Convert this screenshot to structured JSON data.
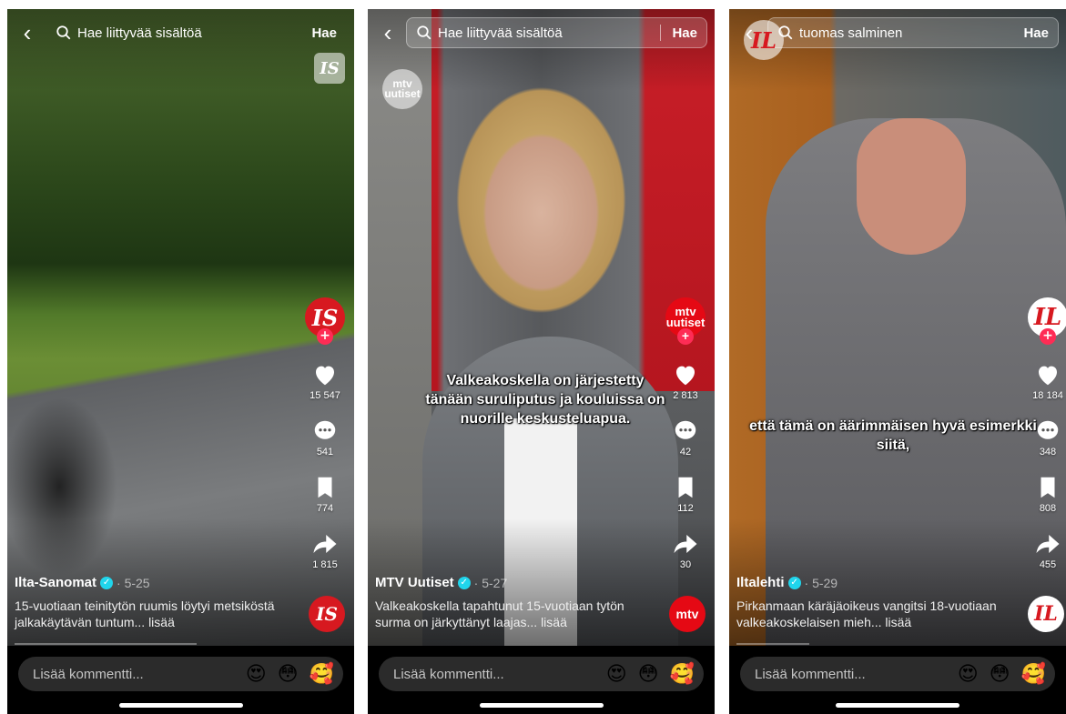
{
  "search_button_label": "Hae",
  "comment_placeholder": "Lisää kommentti...",
  "emojis": [
    "😍",
    "😳",
    "🥰"
  ],
  "colors": {
    "like_red": "#fe2c55",
    "verified": "#20d5ec",
    "comment_bar": "#2b2b2b"
  },
  "screens": [
    {
      "search_text": "Hae liittyvää sisältöä",
      "watermark": "IS",
      "avatar_text": "IS",
      "actions": {
        "likes": "15 547",
        "comments": "541",
        "saves": "774",
        "shares": "1 815"
      },
      "caption": "",
      "author": "Ilta-Sanomat",
      "date": "· 5-25",
      "description": "15-vuotiaan teinitytön ruumis löytyi metsiköstä jalkakäytävän tuntum... lisää",
      "disc_text": "IS"
    },
    {
      "search_text": "Hae liittyvää sisältöä",
      "watermark": "mtv uutiset",
      "avatar_text": "mtv uutiset",
      "actions": {
        "likes": "2 813",
        "comments": "42",
        "saves": "112",
        "shares": "30"
      },
      "caption": "Valkeakoskella on järjestetty tänään suruliputus ja kouluissa on nuorille keskusteluapua.",
      "author": "MTV Uutiset",
      "date": "· 5-27",
      "description": "Valkeakoskella tapahtunut 15-vuotiaan tytön surma on järkyttänyt laajas... lisää",
      "disc_text": "mtv"
    },
    {
      "search_text": "tuomas salminen",
      "watermark": "IL",
      "avatar_text": "IL",
      "actions": {
        "likes": "18 184",
        "comments": "348",
        "saves": "808",
        "shares": "455"
      },
      "caption": "että tämä on äärimmäisen hyvä esimerkki siitä,",
      "author": "Iltalehti",
      "date": "· 5-29",
      "description": "Pirkanmaan käräjäoikeus vangitsi 18-vuotiaan valkeakoskelaisen mieh... lisää",
      "disc_text": "IL"
    }
  ]
}
